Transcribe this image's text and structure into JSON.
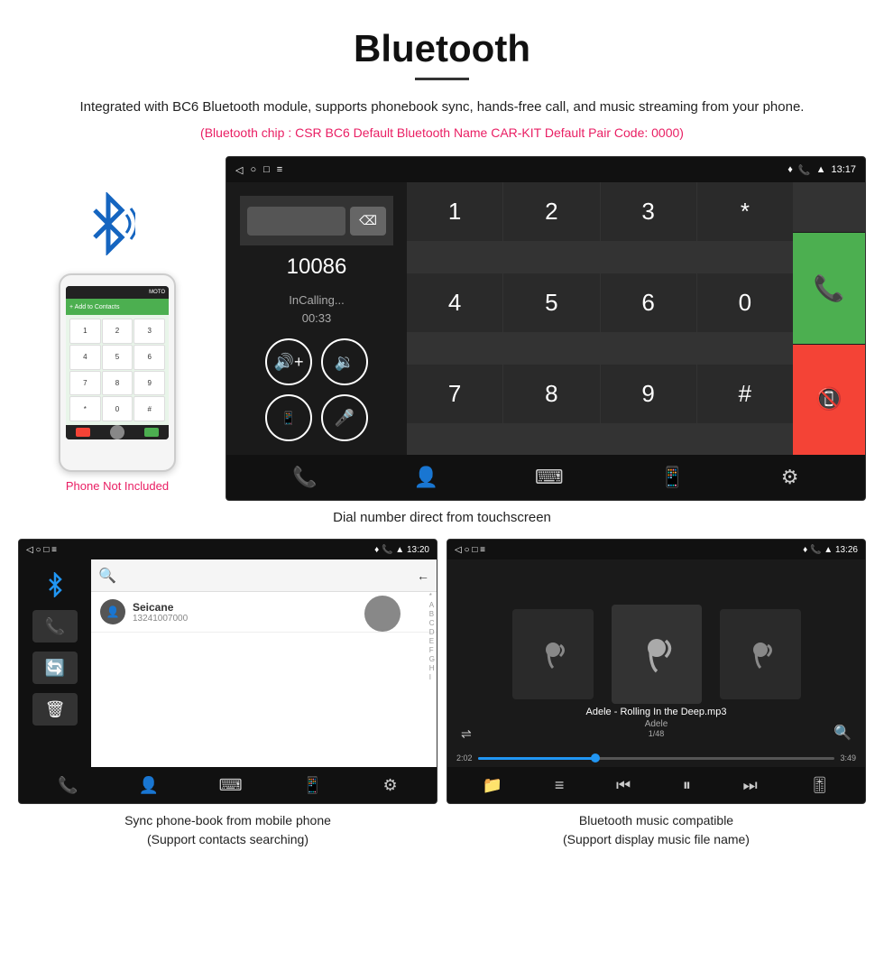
{
  "page": {
    "title": "Bluetooth",
    "description": "Integrated with BC6 Bluetooth module, supports phonebook sync, hands-free call, and music streaming from your phone.",
    "specs": "(Bluetooth chip : CSR BC6    Default Bluetooth Name CAR-KIT    Default Pair Code: 0000)",
    "phone_not_included": "Phone Not Included",
    "caption_dial": "Dial number direct from touchscreen",
    "caption_phonebook": "Sync phone-book from mobile phone",
    "caption_phonebook_sub": "(Support contacts searching)",
    "caption_music": "Bluetooth music compatible",
    "caption_music_sub": "(Support display music file name)"
  },
  "dial_screen": {
    "time": "13:17",
    "number": "10086",
    "status": "InCalling...",
    "timer": "00:33",
    "keys": [
      "1",
      "2",
      "3",
      "*",
      "4",
      "5",
      "6",
      "0",
      "7",
      "8",
      "9",
      "#"
    ]
  },
  "phonebook_screen": {
    "time": "13:20",
    "contact_name": "Seicane",
    "contact_number": "13241007000",
    "alphabet": [
      "*",
      "A",
      "B",
      "C",
      "D",
      "E",
      "F",
      "G",
      "H",
      "I"
    ]
  },
  "music_screen": {
    "time": "13:26",
    "song_title": "Adele - Rolling In the Deep.mp3",
    "artist": "Adele",
    "track_info": "1/48",
    "time_current": "2:02",
    "time_total": "3:49",
    "progress_percent": 33
  }
}
